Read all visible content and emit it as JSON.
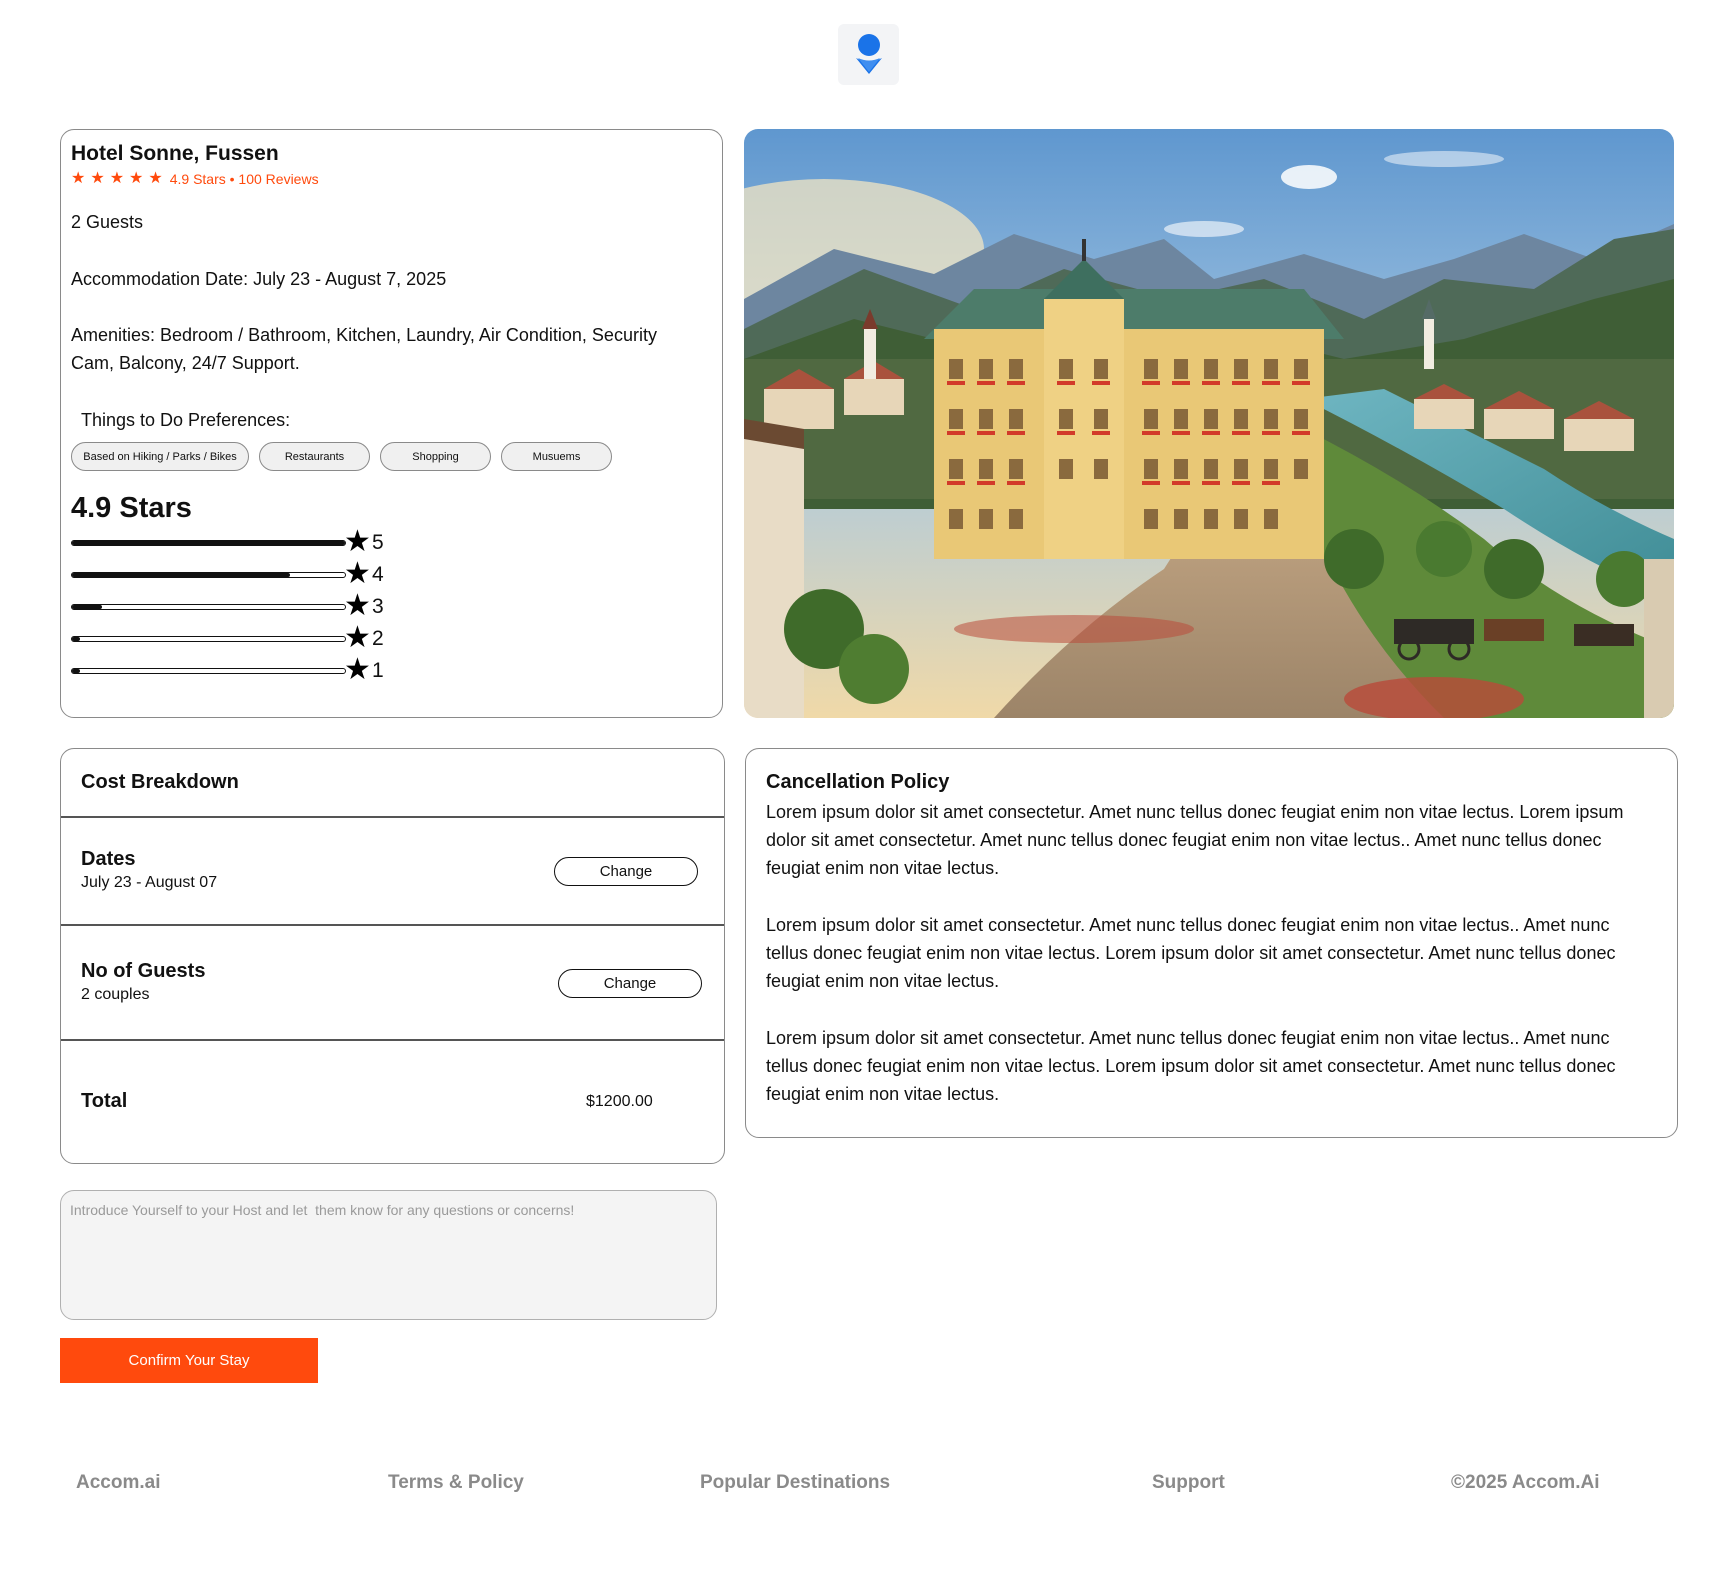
{
  "hotel": {
    "name": "Hotel Sonne, Fussen",
    "rating_text": "4.9 Stars • 100 Reviews",
    "guests": "2 Guests",
    "accommodation_date": "Accommodation Date: July 23 -  August 7, 2025",
    "amenities": "Amenities: Bedroom / Bathroom, Kitchen, Laundry, Air Condition, Security Cam, Balcony, 24/7 Support.",
    "preferences_title": "Things to Do Preferences:",
    "preferences": [
      "Based on Hiking  / Parks / Bikes",
      "Restaurants",
      "Shopping",
      "Musuems"
    ]
  },
  "ratings": {
    "summary": "4.9 Stars",
    "breakdown": [
      {
        "label": "5",
        "fraction": 1.0
      },
      {
        "label": "4",
        "fraction": 0.8
      },
      {
        "label": "3",
        "fraction": 0.11
      },
      {
        "label": "2",
        "fraction": 0.03
      },
      {
        "label": "1",
        "fraction": 0.03
      }
    ]
  },
  "cost": {
    "title": "Cost Breakdown",
    "dates_label": "Dates",
    "dates_value": "July 23 - August 07",
    "guests_label": "No of Guests",
    "guests_value": "2 couples",
    "change_label": "Change",
    "total_label": "Total",
    "total_value": "$1200.00"
  },
  "cancellation": {
    "title": "Cancellation Policy",
    "paragraphs": [
      "Lorem ipsum dolor sit amet consectetur. Amet nunc tellus donec feugiat enim non vitae lectus. Lorem ipsum dolor sit amet consectetur. Amet nunc tellus donec feugiat enim non vitae lectus.. Amet nunc tellus donec feugiat enim non vitae lectus.",
      "Lorem ipsum dolor sit amet consectetur. Amet nunc tellus donec feugiat enim non vitae lectus.. Amet nunc tellus donec feugiat enim non vitae lectus. Lorem ipsum dolor sit amet consectetur. Amet nunc tellus donec feugiat enim non vitae lectus.",
      "Lorem ipsum dolor sit amet consectetur. Amet nunc tellus donec feugiat enim non vitae lectus.. Amet nunc tellus donec feugiat enim non vitae lectus. Lorem ipsum dolor sit amet consectetur. Amet nunc tellus donec feugiat enim non vitae lectus."
    ]
  },
  "message": {
    "placeholder": "Introduce Yourself to your Host and let  them know for any questions or concerns!"
  },
  "confirm_label": "Confirm Your Stay",
  "footer": {
    "brand": "Accom.ai",
    "terms": "Terms & Policy",
    "destinations": "Popular Destinations",
    "support": "Support",
    "copyright": "©2025 Accom.Ai"
  },
  "colors": {
    "accent": "#ff4a0d",
    "logo_blue": "#1a73e8"
  },
  "icons": {
    "logo": "location-pin-icon",
    "star": "star-icon"
  }
}
